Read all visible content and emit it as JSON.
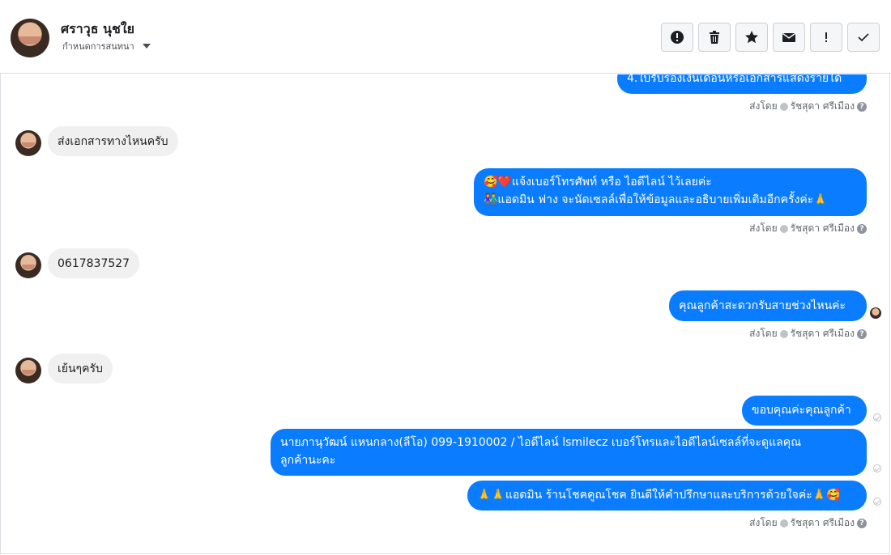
{
  "header": {
    "contact_name": "ศราวุธ นุชใย",
    "assign_label": "กำหนดการสนทนา",
    "actions": [
      "alert-icon",
      "trash-icon",
      "star-icon",
      "envelope-icon",
      "exclamation-icon",
      "check-icon"
    ]
  },
  "messages": {
    "m0": "4.ใบรับรองเงินเดือนหรือเอกสารแสดงรายได้",
    "m1": "ส่งเอกสารทางไหนครับ",
    "m2a": "🥰❤️แจ้งเบอร์โทรศัพท์ หรือ ไอดีไลน์  ไว้เลยค่ะ",
    "m2b": "👫แอดมิน ฟาง จะนัดเซลล์เพื่อให้ข้อมูลและอธิบายเพิ่มเติมอีกครั้งค่ะ🙏",
    "m3": "0617837527",
    "m4": "คุณลูกค้าสะดวกรับสายช่วงไหนค่ะ",
    "m5": "เย้นๆครับ",
    "m6": "ขอบคุณค่ะคุณลูกค้า",
    "m7a": "นายภานุวัฒน์ แหนกลาง(ลีโอ)        099-1910002 / ไอดีไลน์ lsmilecz  เบอร์โทรและไอดีไลน์เซลล์ที่จะดูแลคุณ",
    "m7b": "ลูกค้านะคะ",
    "m8": "🙏🙏แอดมิน ร้านโชคคูณโชค ยินดีให้คำปรึกษาและบริการด้วยใจค่ะ🙏🥰"
  },
  "sent_by": {
    "label": "ส่งโดย",
    "agent": "รัชสุดา ศรีเมือง"
  }
}
